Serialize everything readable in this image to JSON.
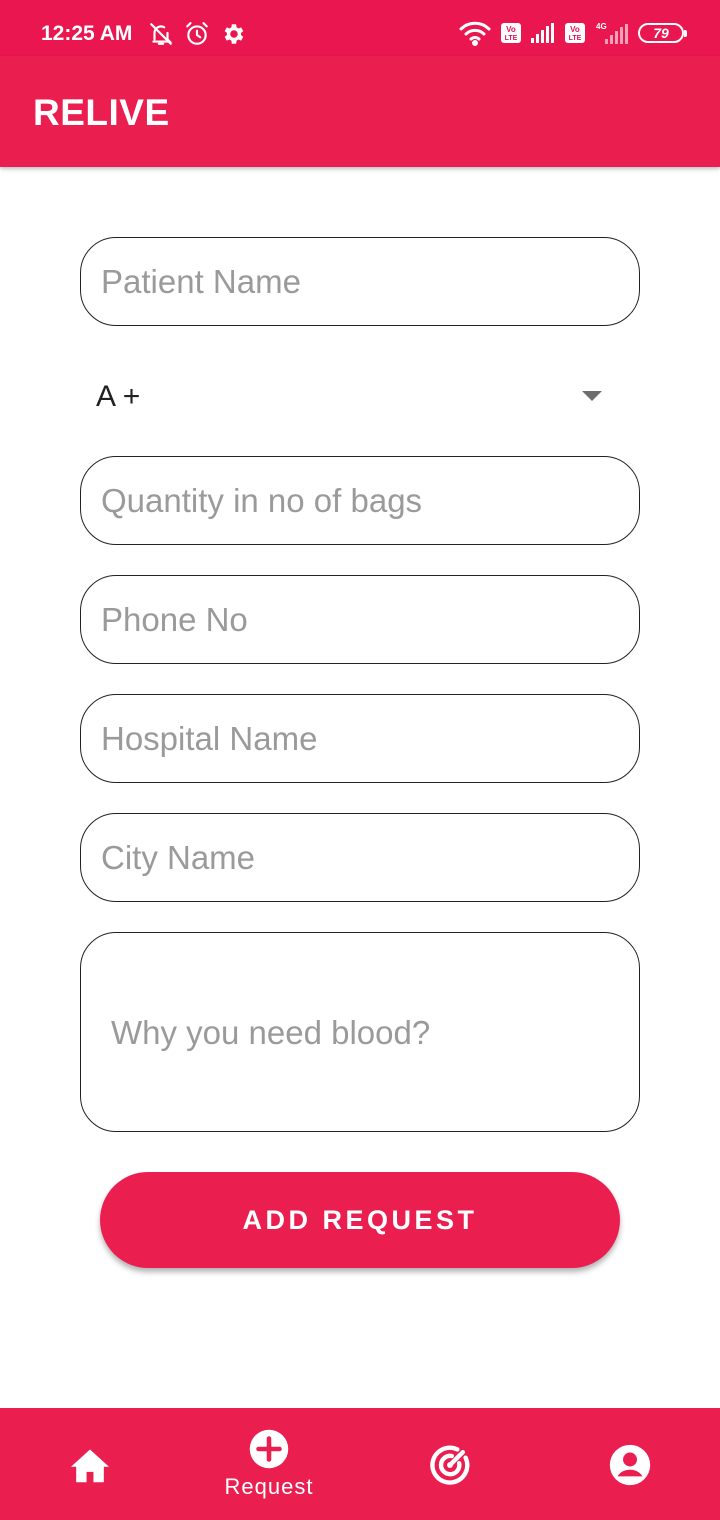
{
  "status_bar": {
    "time": "12:25 AM",
    "battery": "79",
    "icons": [
      "bell-off-icon",
      "alarm-icon",
      "gear-icon",
      "wifi-icon",
      "volte-icon",
      "signal-icon",
      "volte-icon",
      "signal-4g-icon",
      "battery-icon"
    ]
  },
  "app_bar": {
    "title": "RELIVE"
  },
  "form": {
    "patient_name": {
      "placeholder": "Patient Name",
      "value": ""
    },
    "blood_group": {
      "selected": "A +"
    },
    "quantity": {
      "placeholder": "Quantity in no of bags",
      "value": ""
    },
    "phone": {
      "placeholder": "Phone No",
      "value": ""
    },
    "hospital": {
      "placeholder": "Hospital Name",
      "value": ""
    },
    "city": {
      "placeholder": "City Name",
      "value": ""
    },
    "reason": {
      "placeholder": "Why you need blood?",
      "value": ""
    },
    "submit_label": "ADD REQUEST"
  },
  "bottom_nav": {
    "items": [
      {
        "icon": "home-icon",
        "label": ""
      },
      {
        "icon": "add-circle-icon",
        "label": "Request"
      },
      {
        "icon": "radar-icon",
        "label": ""
      },
      {
        "icon": "account-icon",
        "label": ""
      }
    ],
    "selected": "Request"
  },
  "colors": {
    "primary": "#ea1f50",
    "status_bar": "#ea164f",
    "placeholder": "#9a9a9a",
    "field_border": "#222222"
  }
}
